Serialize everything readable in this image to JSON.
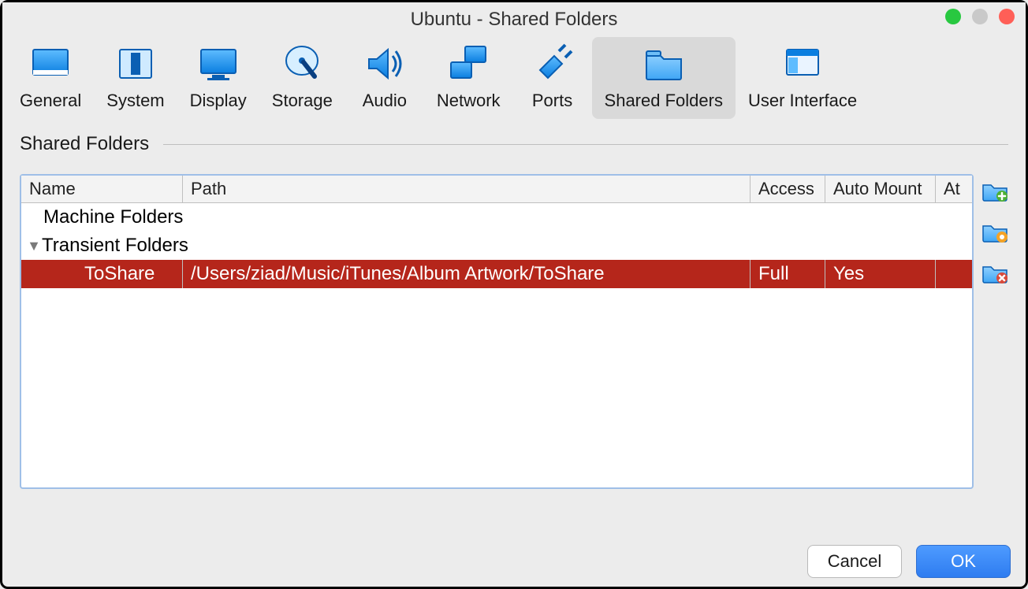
{
  "window": {
    "title": "Ubuntu - Shared Folders"
  },
  "toolbar": {
    "items": [
      {
        "id": "general",
        "label": "General"
      },
      {
        "id": "system",
        "label": "System"
      },
      {
        "id": "display",
        "label": "Display"
      },
      {
        "id": "storage",
        "label": "Storage"
      },
      {
        "id": "audio",
        "label": "Audio"
      },
      {
        "id": "network",
        "label": "Network"
      },
      {
        "id": "ports",
        "label": "Ports"
      },
      {
        "id": "shared-folders",
        "label": "Shared Folders",
        "selected": true
      },
      {
        "id": "user-interface",
        "label": "User Interface"
      }
    ]
  },
  "section": {
    "title": "Shared Folders"
  },
  "table": {
    "columns": {
      "name": "Name",
      "path": "Path",
      "access": "Access",
      "automount": "Auto Mount",
      "at": "At"
    },
    "groups": [
      {
        "label": "Machine Folders",
        "expandable": false,
        "rows": []
      },
      {
        "label": "Transient Folders",
        "expandable": true,
        "expanded": true,
        "rows": [
          {
            "name": "ToShare",
            "path": "/Users/ziad/Music/iTunes/Album Artwork/ToShare",
            "access": "Full",
            "automount": "Yes",
            "at": "",
            "selected": true
          }
        ]
      }
    ]
  },
  "side_actions": {
    "add": "Add shared folder",
    "edit": "Edit shared folder",
    "remove": "Remove shared folder"
  },
  "footer": {
    "cancel": "Cancel",
    "ok": "OK"
  }
}
